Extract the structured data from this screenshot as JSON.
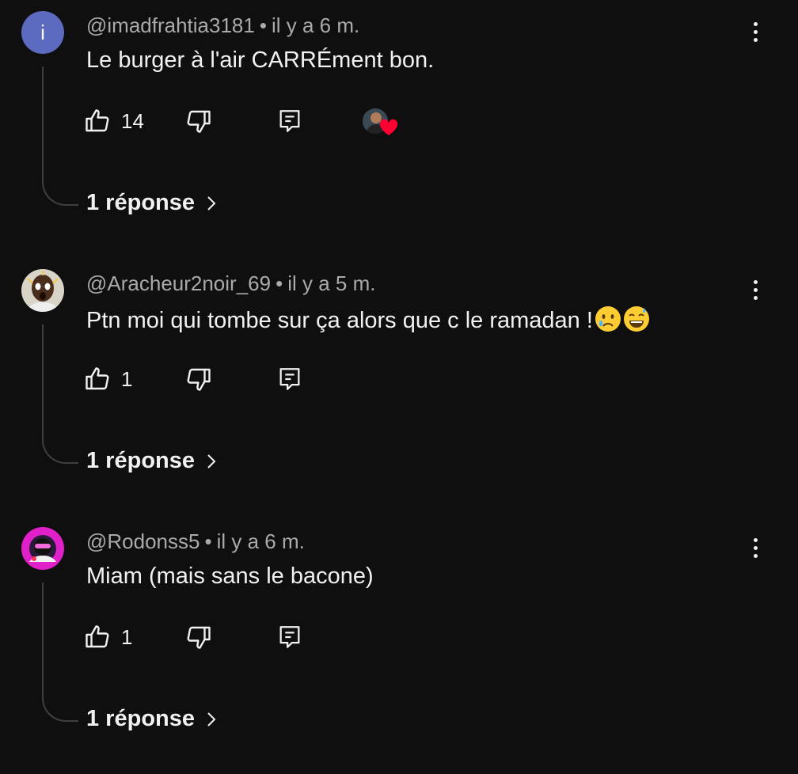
{
  "comments": [
    {
      "avatar_letter": "i",
      "avatar_color": "#5c6bc0",
      "author": "@imadfrahtia3181",
      "time": "il y a 6 m.",
      "text": "Le burger à l'air CARRÉment bon.",
      "emojis": [],
      "likes": "14",
      "creator_heart": true,
      "replies_label": "1 réponse"
    },
    {
      "avatar_letter": "",
      "author": "@Aracheur2noir_69",
      "time": "il y a 5 m.",
      "text": "Ptn moi qui tombe sur ça alors que c le ramadan !",
      "emojis": [
        "crying-face",
        "grinning-sweat-face"
      ],
      "likes": "1",
      "creator_heart": false,
      "replies_label": "1 réponse"
    },
    {
      "avatar_letter": "",
      "author": "@Rodonss5",
      "time": "il y a 6 m.",
      "text": "Miam (mais sans le bacone)",
      "emojis": [],
      "likes": "1",
      "creator_heart": false,
      "replies_label": "1 réponse"
    }
  ],
  "separator": "•",
  "icons": {
    "like": "thumb-up-icon",
    "dislike": "thumb-down-icon",
    "reply": "reply-icon",
    "more": "more-vert-icon",
    "chevron": "chevron-right-icon",
    "heart": "heart-icon"
  },
  "colors": {
    "background": "#0f0f0f",
    "text": "#f1f1f1",
    "secondary": "#aaaaaa",
    "heart": "#ff0033"
  }
}
